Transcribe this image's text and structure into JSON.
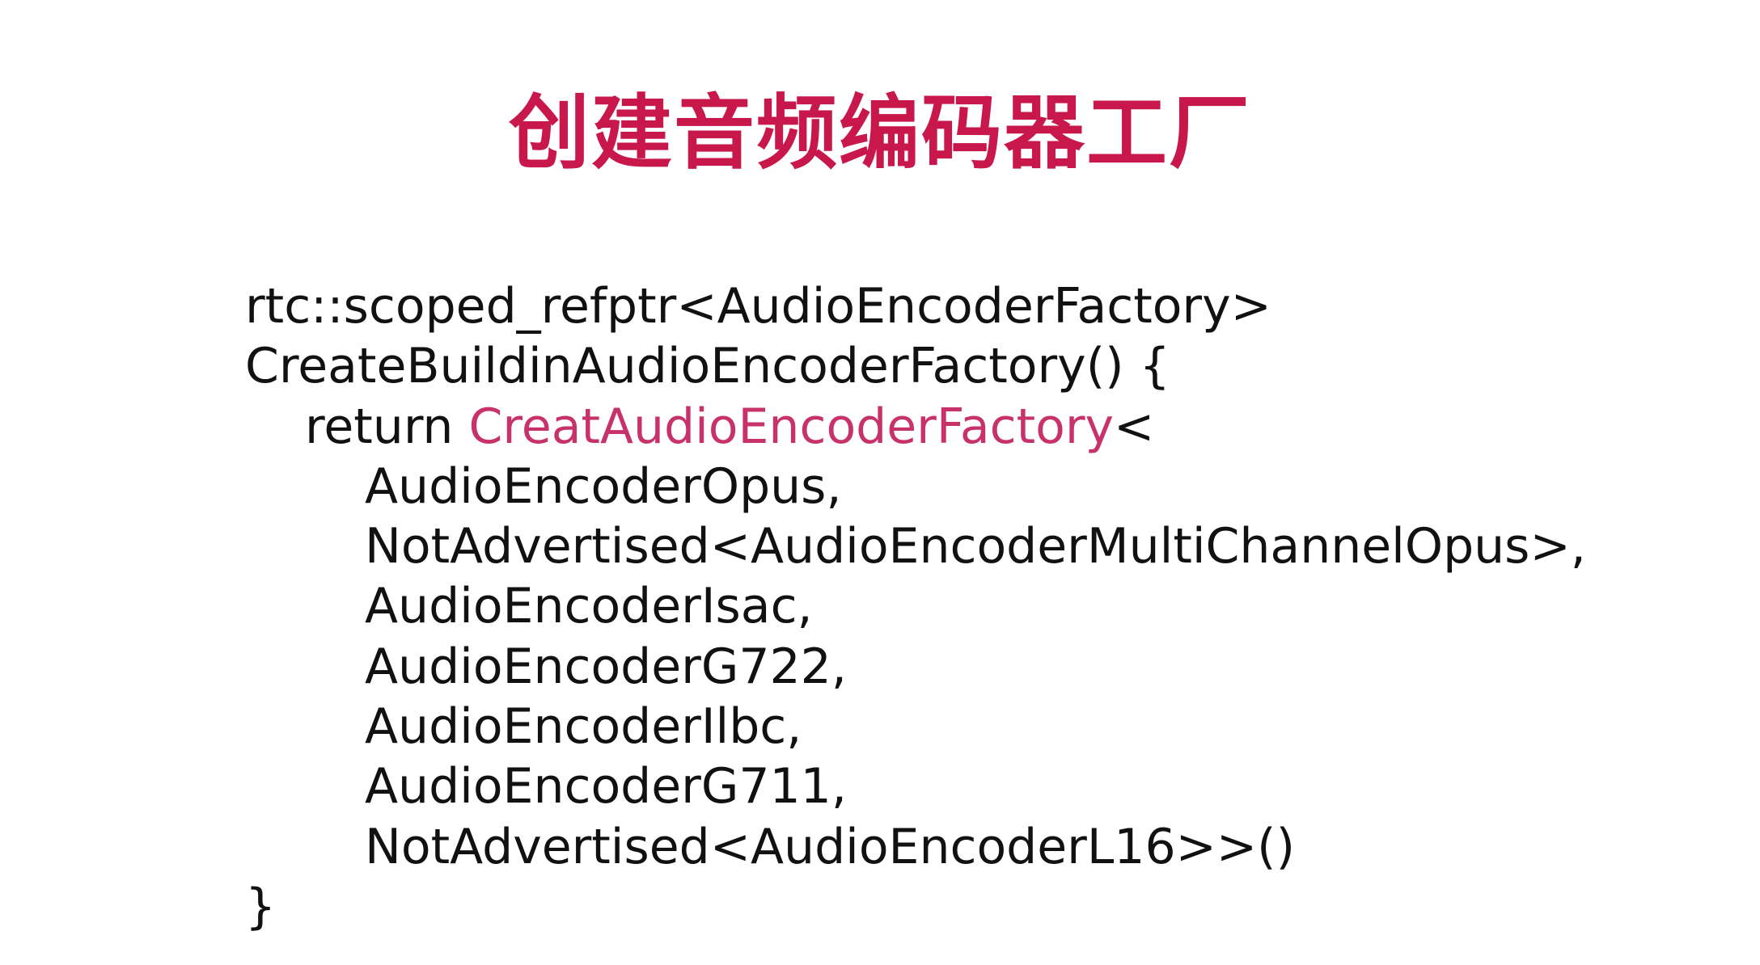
{
  "slide": {
    "title": "创建音频编码器工厂",
    "code": {
      "line1": "rtc::scoped_refptr<AudioEncoderFactory>",
      "line2": "CreateBuildinAudioEncoderFactory() {",
      "line3_keyword": "return ",
      "line3_function": "CreatAudioEncoderFactory",
      "line3_suffix": "<",
      "line4": "AudioEncoderOpus,",
      "line5": "NotAdvertised<AudioEncoderMultiChannelOpus>,",
      "line6": "AudioEncoderIsac,",
      "line7": "AudioEncoderG722,",
      "line8": "AudioEncoderIlbc,",
      "line9": "AudioEncoderG711,",
      "line10": "NotAdvertised<AudioEncoderL16>>()",
      "line11": "}"
    }
  },
  "colors": {
    "title": "#c8174b",
    "highlight": "#c8326a",
    "text": "#111111",
    "background": "#ffffff"
  }
}
